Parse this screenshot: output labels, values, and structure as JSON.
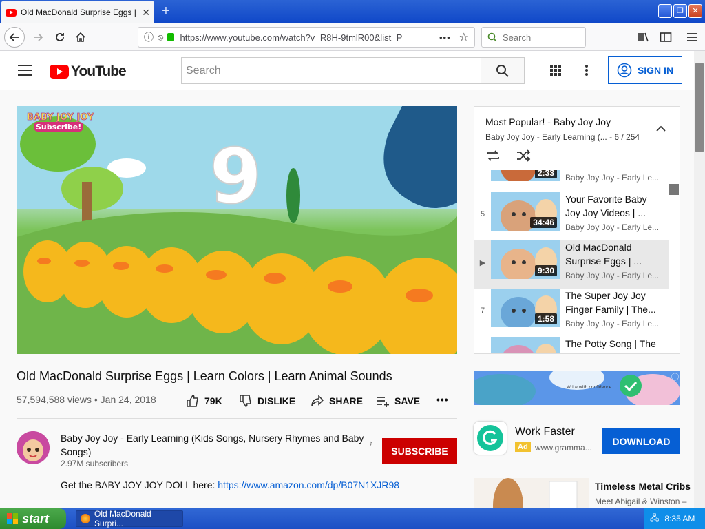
{
  "browser": {
    "tab_title": "Old MacDonald Surprise Eggs | Lea",
    "tab_close": "✕",
    "new_tab": "+",
    "url": "https://www.youtube.com/watch?v=R8H-9tmlR00&list=P",
    "search_placeholder": "Search",
    "page_actions": "•••"
  },
  "youtube": {
    "logo_text": "YouTube",
    "search_placeholder": "Search",
    "sign_in": "SIGN IN"
  },
  "video": {
    "overlay_channel": "BABY JOY JOY",
    "overlay_subscribe": "Subscribe!",
    "overlay_number": "9",
    "title": "Old MacDonald Surprise Eggs | Learn Colors | Learn Animal Sounds",
    "views": "57,594,588 views",
    "date": "Jan 24, 2018",
    "likes": "79K",
    "dislike": "DISLIKE",
    "share": "SHARE",
    "save": "SAVE",
    "more": "•••"
  },
  "channel": {
    "name": "Baby Joy Joy - Early Learning (Kids Songs, Nursery Rhymes and Baby Songs)",
    "subscribers": "2.97M subscribers",
    "subscribe": "SUBSCRIBE",
    "desc_text": "Get the BABY JOY JOY DOLL here: ",
    "desc_link": "https://www.amazon.com/dp/B07N1XJR98"
  },
  "playlist": {
    "title": "Most Popular! - Baby Joy Joy",
    "subtitle": "Baby Joy Joy - Early Learning (... - 6 / 254",
    "items": [
      {
        "num": "",
        "title": "",
        "channel": "Baby Joy Joy - Early Le...",
        "duration": "2:33",
        "color": "#c96a3a"
      },
      {
        "num": "5",
        "title": "Your Favorite Baby Joy Joy Videos | ...",
        "channel": "Baby Joy Joy - Early Le...",
        "duration": "34:46",
        "color": "#d9a27a"
      },
      {
        "num": "▶",
        "title": "Old MacDonald Surprise Eggs | ...",
        "channel": "Baby Joy Joy - Early Le...",
        "duration": "9:30",
        "color": "#e8b48a"
      },
      {
        "num": "7",
        "title": "The Super Joy Joy Finger Family | The...",
        "channel": "Baby Joy Joy - Early Le...",
        "duration": "1:58",
        "color": "#6aa7d8"
      },
      {
        "num": "",
        "title": "The Potty Song | The",
        "channel": "",
        "duration": "",
        "color": "#d993b7"
      }
    ]
  },
  "ads": {
    "banner_text": "Write with confidence",
    "title": "Work Faster",
    "tag": "Ad",
    "url": "www.gramma...",
    "download": "DOWNLOAD"
  },
  "recommendation": {
    "title": "Timeless Metal Cribs",
    "channel": "Meet Abigail & Winston –"
  },
  "taskbar": {
    "start": "start",
    "task": "Old MacDonald Surpri...",
    "time": "8:35 AM"
  }
}
